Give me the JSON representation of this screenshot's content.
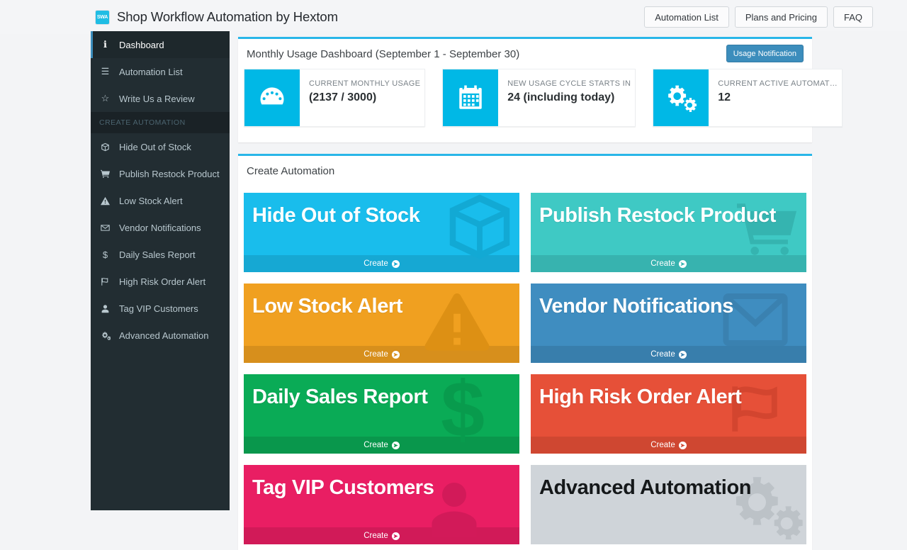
{
  "header": {
    "logo_text": "SWA",
    "title": "Shop Workflow Automation by Hextom",
    "buttons": [
      {
        "label": "Automation List"
      },
      {
        "label": "Plans and Pricing"
      },
      {
        "label": "FAQ"
      }
    ]
  },
  "sidebar": {
    "items": [
      {
        "label": "Dashboard",
        "icon": "info-icon",
        "active": true
      },
      {
        "label": "Automation List",
        "icon": "list-icon",
        "active": false
      },
      {
        "label": "Write Us a Review",
        "icon": "star-icon",
        "active": false
      }
    ],
    "section_header": "CREATE AUTOMATION",
    "automation_items": [
      {
        "label": "Hide Out of Stock",
        "icon": "cube-icon"
      },
      {
        "label": "Publish Restock Product",
        "icon": "cart-icon"
      },
      {
        "label": "Low Stock Alert",
        "icon": "warning-icon"
      },
      {
        "label": "Vendor Notifications",
        "icon": "envelope-icon"
      },
      {
        "label": "Daily Sales Report",
        "icon": "dollar-icon"
      },
      {
        "label": "High Risk Order Alert",
        "icon": "flag-icon"
      },
      {
        "label": "Tag VIP Customers",
        "icon": "user-icon"
      },
      {
        "label": "Advanced Automation",
        "icon": "gears-icon"
      }
    ]
  },
  "dashboard": {
    "title": "Monthly Usage Dashboard (September 1 - September 30)",
    "usage_button": "Usage Notification",
    "stats": [
      {
        "label": "CURRENT MONTHLY USAGE",
        "value": "(2137 / 3000)",
        "icon": "gauge-icon"
      },
      {
        "label": "NEW USAGE CYCLE STARTS IN",
        "value": "24 (including today)",
        "icon": "calendar-icon"
      },
      {
        "label": "CURRENT ACTIVE AUTOMAT…",
        "value": "12",
        "icon": "gears-icon"
      }
    ]
  },
  "create_automation": {
    "title": "Create Automation",
    "create_label": "Create",
    "cards": [
      {
        "title": "Hide Out of Stock",
        "art": "cube-icon",
        "color": "#19bdec",
        "foot_color": "#16a8d3",
        "dark": false
      },
      {
        "title": "Publish Restock Product",
        "art": "cart-icon",
        "color": "#3fc9c4",
        "foot_color": "#37b3af",
        "dark": false
      },
      {
        "title": "Low Stock Alert",
        "art": "warning-icon",
        "color": "#f0a020",
        "foot_color": "#d78f1c",
        "dark": false
      },
      {
        "title": "Vendor Notifications",
        "art": "envelope-icon",
        "color": "#3f8dc0",
        "foot_color": "#387eac",
        "dark": false
      },
      {
        "title": "Daily Sales Report",
        "art": "dollar-icon",
        "color": "#0aab56",
        "foot_color": "#09974c",
        "dark": false
      },
      {
        "title": "High Risk Order Alert",
        "art": "flag-icon",
        "color": "#e65038",
        "foot_color": "#cf4731",
        "dark": false
      },
      {
        "title": "Tag VIP Customers",
        "art": "user-icon",
        "color": "#e91e63",
        "foot_color": "#d11a58",
        "dark": false
      },
      {
        "title": "Advanced Automation",
        "art": "gears-icon",
        "color": "#cfd4d9",
        "foot_color": "#bcc2c7",
        "dark": true
      }
    ]
  }
}
